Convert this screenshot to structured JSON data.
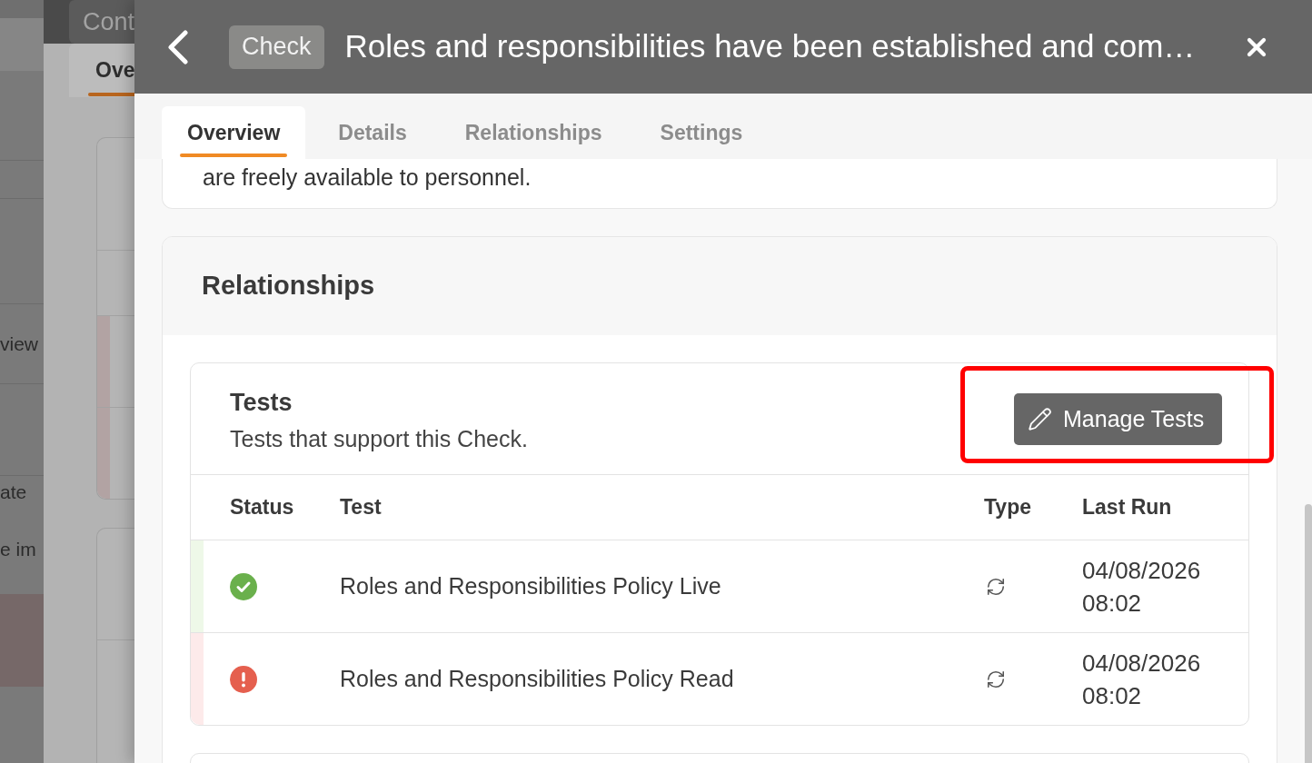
{
  "background_page": {
    "rows": [
      [
        "view"
      ],
      [
        "ate",
        "e im"
      ]
    ]
  },
  "behind_panel": {
    "type_badge": "Cont",
    "tabs": [
      {
        "label": "Ove",
        "selected": true
      }
    ]
  },
  "panel": {
    "type_badge": "Check",
    "title": "Roles and responsibilities have been established and com…"
  },
  "tabs": [
    {
      "label": "Overview",
      "selected": true
    },
    {
      "label": "Details",
      "selected": false
    },
    {
      "label": "Relationships",
      "selected": false
    },
    {
      "label": "Settings",
      "selected": false
    }
  ],
  "description_card": {
    "text": "are freely available to personnel."
  },
  "relationships": {
    "title": "Relationships",
    "tests": {
      "title": "Tests",
      "subtitle": "Tests that support this Check.",
      "manage_button": "Manage Tests",
      "highlighted": true,
      "columns": [
        "Status",
        "Test",
        "Type",
        "Last Run"
      ],
      "rows": [
        {
          "kind": "passed",
          "name": "Roles and Responsibilities Policy Live",
          "last_run": "04/08/2026 08:02"
        },
        {
          "kind": "failed",
          "name": "Roles and Responsibilities Policy Read",
          "last_run": "04/08/2026 08:02"
        }
      ]
    }
  }
}
